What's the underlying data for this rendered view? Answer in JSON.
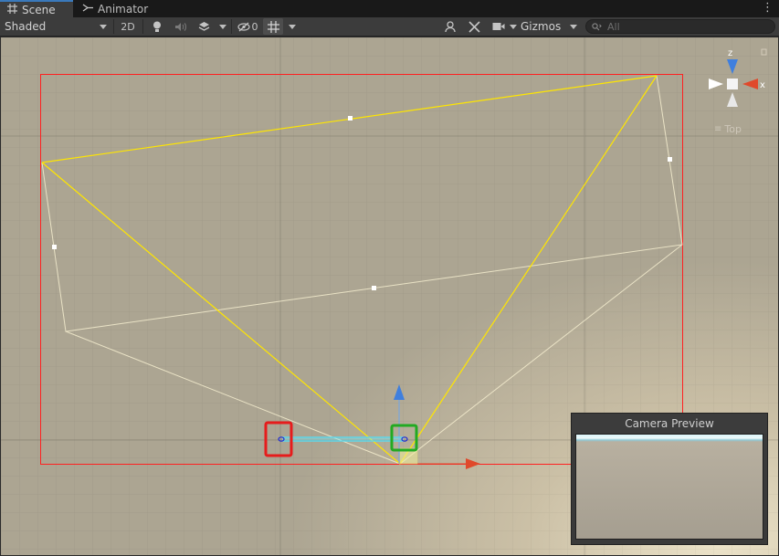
{
  "tabs": [
    {
      "label": "Scene",
      "icon": "grid-icon"
    },
    {
      "label": "Animator",
      "icon": "animator-icon"
    }
  ],
  "toolbar": {
    "shading_mode": "Shaded",
    "mode_2d_label": "2D",
    "hidden_count": "0",
    "gizmos_label": "Gizmos",
    "search_placeholder": "All"
  },
  "gizmo": {
    "z_label": "z",
    "x_label": "x",
    "view_label": "Top"
  },
  "camera_preview": {
    "title": "Camera Preview"
  },
  "colors": {
    "selection_box": "#ff2020",
    "frustum": "#ffe600",
    "highlight_red": "#e61c1c",
    "highlight_green": "#22aa22",
    "axis_x": "#e0492b",
    "axis_y": "#3f7fde",
    "viewport_bg": "#b3aa96"
  }
}
